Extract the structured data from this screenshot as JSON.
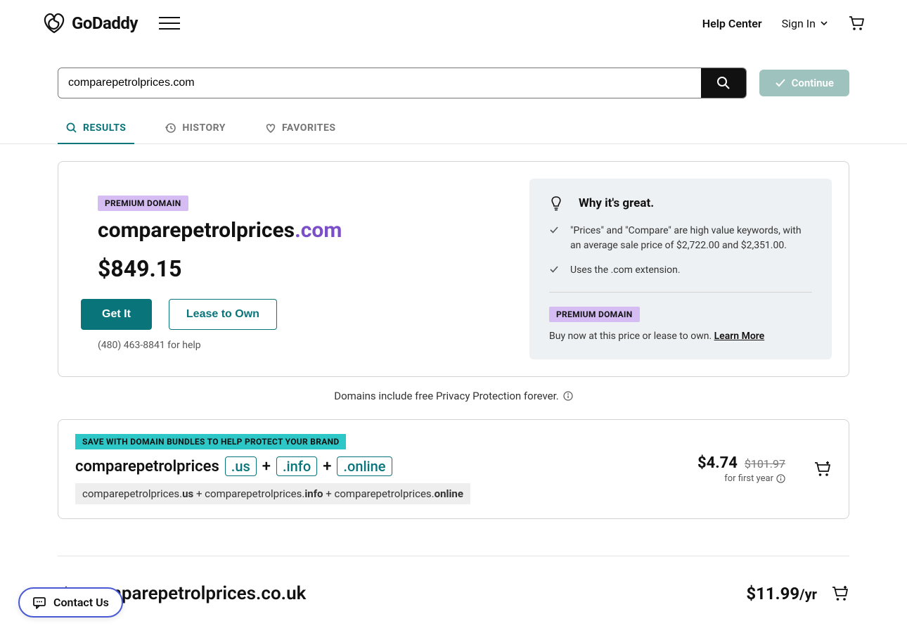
{
  "header": {
    "help_center": "Help Center",
    "sign_in": "Sign In"
  },
  "search": {
    "value": "comparepetrolprices.com",
    "continue": "Continue"
  },
  "tabs": {
    "results": "RESULTS",
    "history": "HISTORY",
    "favorites": "FAVORITES"
  },
  "premium": {
    "badge": "PREMIUM DOMAIN",
    "name_base": "comparepetrolprices",
    "name_tld": ".com",
    "price": "$849.15",
    "get_it": "Get It",
    "lease": "Lease to Own",
    "phone_help": "(480) 463-8841 for help"
  },
  "why": {
    "title": "Why it's great.",
    "item1": "\"Prices\" and \"Compare\" are high value keywords, with an average sale price of $2,722.00 and $2,351.00.",
    "item2": "Uses the .com extension.",
    "badge": "PREMIUM DOMAIN",
    "footer_text": "Buy now at this price or lease to own. ",
    "learn_more": "Learn More"
  },
  "privacy": "Domains include free Privacy Protection forever.",
  "bundle": {
    "badge": "SAVE WITH DOMAIN BUNDLES TO HELP PROTECT YOUR BRAND",
    "base": "comparepetrolprices",
    "tld1": ".us",
    "tld2": ".info",
    "tld3": ".online",
    "plus": "+",
    "sub_p1": "comparepetrolprices.",
    "sub_b1": "us",
    "sub_p2": " + comparepetrolprices.",
    "sub_b2": "info",
    "sub_p3": " + comparepetrolprices.",
    "sub_b3": "online",
    "price": "$4.74",
    "strike": "$101.97",
    "term": "for first year"
  },
  "result1": {
    "domain": "comparepetrolprices.co.uk",
    "price": "$11.99",
    "per": "/yr"
  },
  "contact": "Contact Us"
}
